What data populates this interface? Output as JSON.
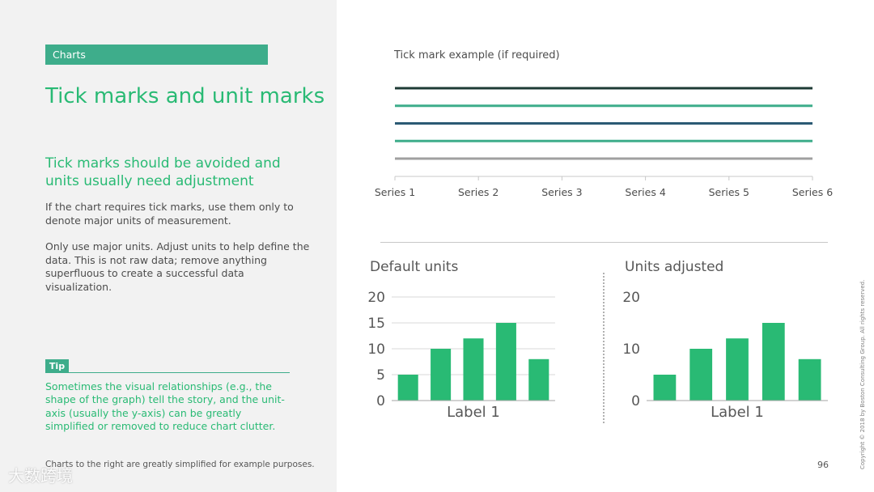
{
  "section_tag": "Charts",
  "title": "Tick marks and unit marks",
  "subtitle": "Tick marks should be avoided and units usually need adjustment",
  "paragraphs": [
    "If the chart requires tick marks, use them only to denote major units of measurement.",
    "Only use major units. Adjust units to help define the data. This is not raw data; remove anything superfluous to create a successful data visualization."
  ],
  "tip": {
    "label": "Tip",
    "text": "Sometimes the visual relationships (e.g., the shape of the graph) tell the story, and the unit-axis (usually the y-axis) can be greatly simplified or removed to reduce chart clutter."
  },
  "footnote": "Charts to the right are greatly simplified for example purposes.",
  "watermark": "大数跨境",
  "page_number": "96",
  "copyright": "Copyright © 2018 by Boston Consulting Group. All rights reserved.",
  "chart_data": [
    {
      "type": "line",
      "title": "Tick mark example (if required)",
      "categories": [
        "Series 1",
        "Series 2",
        "Series 3",
        "Series 4",
        "Series 5",
        "Series 6"
      ],
      "x_ticks": true,
      "y_axis_visible": false,
      "series": [
        {
          "values": [
            5,
            5,
            5,
            5,
            5,
            5
          ],
          "color": "#1e3b35"
        },
        {
          "values": [
            4,
            4,
            4,
            4,
            4,
            4
          ],
          "color": "#3ead8b"
        },
        {
          "values": [
            3,
            3,
            3,
            3,
            3,
            3
          ],
          "color": "#2b5a74"
        },
        {
          "values": [
            2,
            2,
            2,
            2,
            2,
            2
          ],
          "color": "#3ead8b"
        },
        {
          "values": [
            1,
            1,
            1,
            1,
            1,
            1
          ],
          "color": "#a0a0a0"
        }
      ],
      "ylim": [
        0,
        5
      ]
    },
    {
      "type": "bar",
      "title": "Default units",
      "xlabel": "Label 1",
      "values": [
        5,
        10,
        12,
        15,
        8
      ],
      "ylim": [
        0,
        20
      ],
      "yticks": [
        "0",
        "5",
        "10",
        "15",
        "20"
      ],
      "tick_values": [
        0,
        5,
        10,
        15,
        20
      ],
      "grid": true,
      "bar_color": "#29ba74"
    },
    {
      "type": "bar",
      "title": "Units adjusted",
      "xlabel": "Label 1",
      "values": [
        5,
        10,
        12,
        15,
        8
      ],
      "ylim": [
        0,
        20
      ],
      "yticks": [
        "0",
        "10",
        "20"
      ],
      "tick_values": [
        0,
        10,
        20
      ],
      "grid": false,
      "bar_color": "#29ba74"
    }
  ]
}
